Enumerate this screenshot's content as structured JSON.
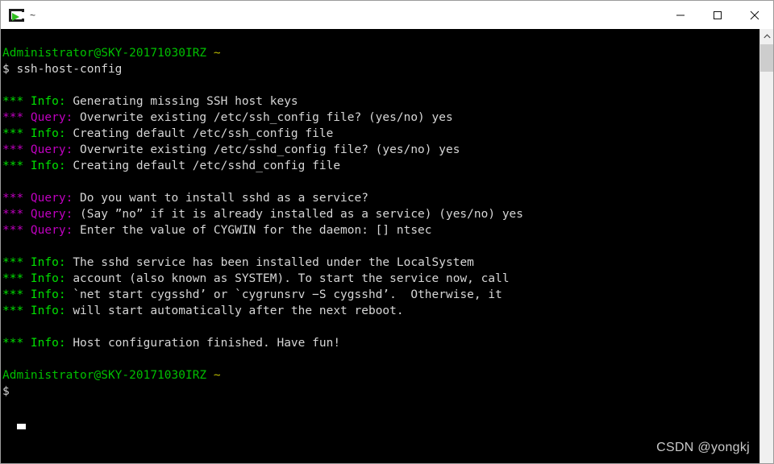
{
  "window": {
    "title": "~",
    "icon": "terminal-icon",
    "controls": {
      "minimize": "—",
      "maximize": "□",
      "close": "✕"
    }
  },
  "terminal": {
    "background_color": "#000000",
    "default_text_color": "#cfcfcf",
    "colors": {
      "prompt_green": "#00c000",
      "info_green": "#00e000",
      "query_magenta": "#c000c0",
      "tilde_yellow": "#b8b800",
      "text_white": "#d6d6d6"
    },
    "lines": [
      {
        "type": "blank",
        "segments": []
      },
      {
        "type": "prompt",
        "segments": [
          {
            "text": "Administrator@SKY-20171030IRZ",
            "color": "green"
          },
          {
            "text": " ",
            "color": "white"
          },
          {
            "text": "~",
            "color": "yellow"
          }
        ]
      },
      {
        "type": "command",
        "segments": [
          {
            "text": "$ ssh-host-config",
            "color": "white"
          }
        ]
      },
      {
        "type": "blank",
        "segments": []
      },
      {
        "type": "info",
        "segments": [
          {
            "text": "*** ",
            "color": "bgreen"
          },
          {
            "text": "Info: ",
            "color": "bgreen"
          },
          {
            "text": "Generating missing SSH host keys",
            "color": "white"
          }
        ]
      },
      {
        "type": "query",
        "segments": [
          {
            "text": "*** ",
            "color": "magenta"
          },
          {
            "text": "Query: ",
            "color": "magenta"
          },
          {
            "text": "Overwrite existing /etc/ssh_config file? (yes/no) yes",
            "color": "white"
          }
        ]
      },
      {
        "type": "info",
        "segments": [
          {
            "text": "*** ",
            "color": "bgreen"
          },
          {
            "text": "Info: ",
            "color": "bgreen"
          },
          {
            "text": "Creating default /etc/ssh_config file",
            "color": "white"
          }
        ]
      },
      {
        "type": "query",
        "segments": [
          {
            "text": "*** ",
            "color": "magenta"
          },
          {
            "text": "Query: ",
            "color": "magenta"
          },
          {
            "text": "Overwrite existing /etc/sshd_config file? (yes/no) yes",
            "color": "white"
          }
        ]
      },
      {
        "type": "info",
        "segments": [
          {
            "text": "*** ",
            "color": "bgreen"
          },
          {
            "text": "Info: ",
            "color": "bgreen"
          },
          {
            "text": "Creating default /etc/sshd_config file",
            "color": "white"
          }
        ]
      },
      {
        "type": "blank",
        "segments": []
      },
      {
        "type": "query",
        "segments": [
          {
            "text": "*** ",
            "color": "magenta"
          },
          {
            "text": "Query: ",
            "color": "magenta"
          },
          {
            "text": "Do you want to install sshd as a service?",
            "color": "white"
          }
        ]
      },
      {
        "type": "query",
        "segments": [
          {
            "text": "*** ",
            "color": "magenta"
          },
          {
            "text": "Query: ",
            "color": "magenta"
          },
          {
            "text": "(Say ”no” if it is already installed as a service) (yes/no) yes",
            "color": "white"
          }
        ]
      },
      {
        "type": "query",
        "segments": [
          {
            "text": "*** ",
            "color": "magenta"
          },
          {
            "text": "Query: ",
            "color": "magenta"
          },
          {
            "text": "Enter the value of CYGWIN for the daemon: [] ntsec",
            "color": "white"
          }
        ]
      },
      {
        "type": "blank",
        "segments": []
      },
      {
        "type": "info",
        "segments": [
          {
            "text": "*** ",
            "color": "bgreen"
          },
          {
            "text": "Info: ",
            "color": "bgreen"
          },
          {
            "text": "The sshd service has been installed under the LocalSystem",
            "color": "white"
          }
        ]
      },
      {
        "type": "info",
        "segments": [
          {
            "text": "*** ",
            "color": "bgreen"
          },
          {
            "text": "Info: ",
            "color": "bgreen"
          },
          {
            "text": "account (also known as SYSTEM). To start the service now, call",
            "color": "white"
          }
        ]
      },
      {
        "type": "info",
        "segments": [
          {
            "text": "*** ",
            "color": "bgreen"
          },
          {
            "text": "Info: ",
            "color": "bgreen"
          },
          {
            "text": "`net start cygsshd’ or `cygrunsrv −S cygsshd’.  Otherwise, it",
            "color": "white"
          }
        ]
      },
      {
        "type": "info",
        "segments": [
          {
            "text": "*** ",
            "color": "bgreen"
          },
          {
            "text": "Info: ",
            "color": "bgreen"
          },
          {
            "text": "will start automatically after the next reboot.",
            "color": "white"
          }
        ]
      },
      {
        "type": "blank",
        "segments": []
      },
      {
        "type": "info",
        "segments": [
          {
            "text": "*** ",
            "color": "bgreen"
          },
          {
            "text": "Info: ",
            "color": "bgreen"
          },
          {
            "text": "Host configuration finished. Have fun!",
            "color": "white"
          }
        ]
      },
      {
        "type": "blank",
        "segments": []
      },
      {
        "type": "prompt",
        "segments": [
          {
            "text": "Administrator@SKY-20171030IRZ",
            "color": "green"
          },
          {
            "text": " ",
            "color": "white"
          },
          {
            "text": "~",
            "color": "yellow"
          }
        ]
      },
      {
        "type": "command",
        "segments": [
          {
            "text": "$ ",
            "color": "white"
          }
        ]
      }
    ],
    "cursor_visible": true
  },
  "watermark": {
    "text": "CSDN @yongkj",
    "color": "#c9c9c9"
  },
  "scrollbar": {
    "up_arrow": "scroll-up-icon",
    "thumb_visible": true
  }
}
